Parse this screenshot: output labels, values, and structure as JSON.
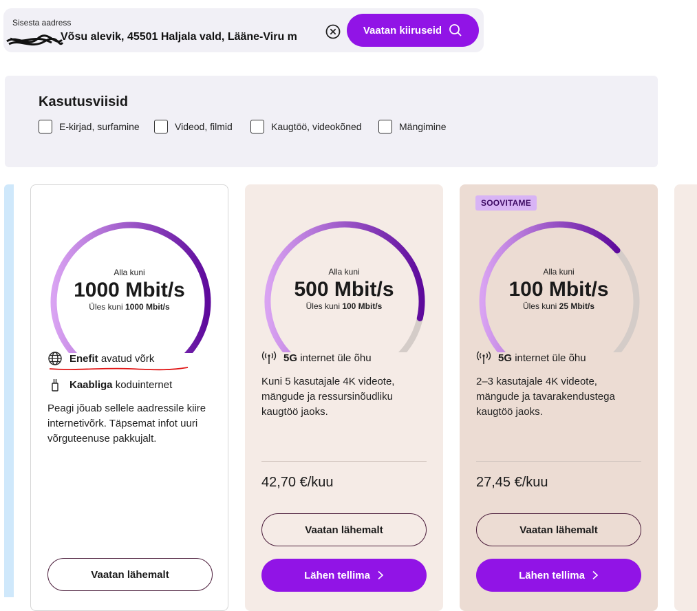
{
  "address": {
    "label": "Sisesta aadress",
    "value": "Võsu alevik, 45501 Haljala vald, Lääne-Viru m",
    "search_label": "Vaatan kiiruseid"
  },
  "usage": {
    "title": "Kasutusviisid",
    "options": [
      {
        "label": "E-kirjad, surfamine",
        "checked": false
      },
      {
        "label": "Videod, filmid",
        "checked": false
      },
      {
        "label": "Kaugtöö, videokõned",
        "checked": false
      },
      {
        "label": "Mängimine",
        "checked": false
      }
    ]
  },
  "cards": [
    {
      "down_label": "Alla kuni",
      "speed": "1000 Mbit/s",
      "up_prefix": "Üles kuni",
      "up_value": "1000 Mbit/s",
      "gauge_level": 1.0,
      "feature1_bold": "Enefit",
      "feature1_text": "avatud võrk",
      "feature2_bold": "Kaabliga",
      "feature2_text": "koduinternet",
      "description": "Peagi jõuab sellele aadressile kiire internetivõrk. Täpsemat infot uuri võrguteenuse pakkujalt.",
      "details_label": "Vaatan lähemalt"
    },
    {
      "down_label": "Alla kuni",
      "speed": "500 Mbit/s",
      "up_prefix": "Üles kuni",
      "up_value": "100 Mbit/s",
      "gauge_level": 0.88,
      "feature_bold": "5G",
      "feature_text": "internet üle õhu",
      "description": "Kuni 5 kasutajale 4K videote, mängude ja ressursinõudliku kaugtöö jaoks.",
      "price": "42,70 €/kuu",
      "details_label": "Vaatan lähemalt",
      "order_label": "Lähen tellima"
    },
    {
      "badge": "SOOVITAME",
      "down_label": "Alla kuni",
      "speed": "100 Mbit/s",
      "up_prefix": "Üles kuni",
      "up_value": "25 Mbit/s",
      "gauge_level": 0.68,
      "feature_bold": "5G",
      "feature_text": "internet üle õhu",
      "description": "2–3 kasutajale 4K videote, mängude ja tavarakendustega kaugtöö jaoks.",
      "price": "27,45 €/kuu",
      "details_label": "Vaatan lähemalt",
      "order_label": "Lähen tellima"
    }
  ],
  "colors": {
    "accent": "#9114e6",
    "gauge_light": "#d9a3f2",
    "gauge_dark": "#5e0a9c",
    "gauge_track": "#d4ccc8"
  }
}
